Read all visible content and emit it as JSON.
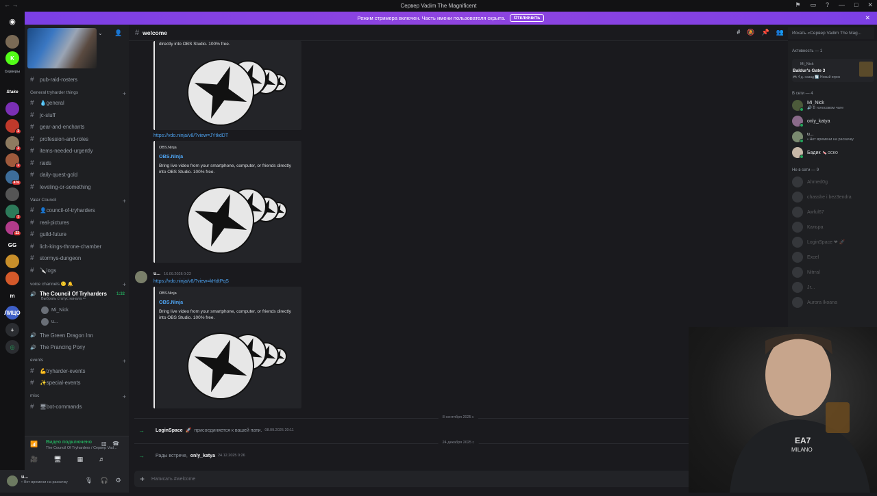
{
  "window": {
    "title": "Сервер Vadim The Magnificent"
  },
  "banner": {
    "text": "Режим стримера включен. Часть имени пользователя скрыта.",
    "button": "Отключить"
  },
  "servers": [
    {
      "icon": "discord-icon",
      "color": "#5865f2"
    },
    {
      "icon": "server-avatar",
      "color": "#7a6a55"
    },
    {
      "icon": "kick-icon",
      "color": "#53fc18",
      "label": "K"
    },
    {
      "icon": "server-label",
      "label": "Серверы"
    },
    {
      "icon": "stake-icon",
      "label": "Stake"
    },
    {
      "icon": "server-avatar",
      "color": "#7b2fb5"
    },
    {
      "icon": "server-avatar",
      "color": "#c0392b",
      "badge": "3"
    },
    {
      "icon": "server-avatar",
      "color": "#8e7b60",
      "badge": "3"
    },
    {
      "icon": "server-avatar",
      "color": "#a05a3c",
      "badge": "1"
    },
    {
      "icon": "server-avatar",
      "color": "#3d6d9a",
      "badge": "476"
    },
    {
      "icon": "server-avatar",
      "color": "#555"
    },
    {
      "icon": "server-avatar",
      "color": "#2d7a5a",
      "badge": "1"
    },
    {
      "icon": "server-avatar",
      "color": "#b23b8a",
      "badge": "22"
    },
    {
      "icon": "gg-icon",
      "label": "GG"
    },
    {
      "icon": "server-avatar",
      "color": "#c98f2a"
    },
    {
      "icon": "server-avatar",
      "color": "#d4592a"
    },
    {
      "icon": "m-icon",
      "label": "m"
    },
    {
      "icon": "server-avatar",
      "color": "#3e5fc7",
      "label": "ЛИЦО"
    },
    {
      "icon": "add-server-icon",
      "label": "+"
    },
    {
      "icon": "discover-icon"
    }
  ],
  "sidebar": {
    "channels_top": [
      {
        "name": "pub-raid-rosters"
      }
    ],
    "categories": [
      {
        "name": "General tryharder things",
        "channels": [
          "💧general",
          "jc-stuff",
          "gear-and-enchants",
          "profession-and-roles",
          "items-needed-urgently",
          "raids",
          "daily-quest-gold",
          "leveling-or-something"
        ]
      },
      {
        "name": "Valar Council",
        "channels": [
          "👤council-of-tryharders",
          "real-pictures",
          "guild-future",
          "lich-kings-throne-chamber",
          "stormys-dungeon",
          "🔪logs"
        ]
      },
      {
        "name": "voice channels 🙂 🔔",
        "voice": [
          {
            "name": "The Council Of Tryharders",
            "active": true,
            "time": "1:32",
            "status": "Выбрать статус канала ✏",
            "users": [
              "Mi_Nick",
              "u..."
            ]
          },
          {
            "name": "The Green Dragon Inn"
          },
          {
            "name": "The Prancing Pony"
          }
        ]
      },
      {
        "name": "events",
        "channels": [
          "💪tryharder-events",
          "✨special-events"
        ]
      },
      {
        "name": "misc",
        "channels": [
          "🖥bot-commands"
        ]
      }
    ]
  },
  "voice_panel": {
    "status": "Видео подключено",
    "channel": "The Council Of Tryharders / Сервер Vad..."
  },
  "user_panel": {
    "name": "u...",
    "status": "• Нет времени на раскачку"
  },
  "channel": {
    "name": "welcome",
    "composer_placeholder": "Написать #welcome"
  },
  "messages": {
    "embed_top_desc_tail": "directly into OBS Studio. 100% free.",
    "link1": "https://vdo.ninja/v8/?view=JYtkdDT",
    "embed": {
      "provider": "OBS.Ninja",
      "title": "OBS.Ninja",
      "description": "Bring live video from your smartphone, computer, or friends directly into OBS Studio. 100% free."
    },
    "msg2": {
      "author": "u...",
      "timestamp": "16.09.2025 0:22",
      "link": "https://vdo.ninja/v8/?view=kHdtPqS"
    },
    "divider1": "8 сентября 2025 г.",
    "join1": {
      "name": "LoginSpace",
      "emoji": "🚀",
      "text": "присоединяется к вашей пати.",
      "timestamp": "08.09.2025 20:11"
    },
    "divider2": "24 декабря 2025 г.",
    "join2": {
      "prefix": "Рады встрече,",
      "name": "only_katya",
      "timestamp": "24.12.2025 0:26"
    }
  },
  "search": {
    "placeholder": "Искать «Сервер Vadim The Mag..."
  },
  "members": {
    "activity_header": "Активность — 1",
    "activity": {
      "user": "Mi_Nick",
      "game": "Baldur's Gate 3",
      "meta": "🎮 4 д. назад  🔄 Новый игрок"
    },
    "online_header": "В сети — 4",
    "online": [
      {
        "name": "Mi_Nick",
        "sub": "🔊 В голосовом чате",
        "color": "#4c5a3a"
      },
      {
        "name": "only_katya",
        "sub": "",
        "color": "#8a6a8a"
      },
      {
        "name": "u...",
        "sub": "• Нет времени на раскачку",
        "color": "#7a8a70"
      },
      {
        "name": "Бадик",
        "sub": "",
        "color": "#c7b8a8",
        "tag": "🍬 GCKO"
      }
    ],
    "offline_header": "Не в сети — 9",
    "offline": [
      "Ahmed0g",
      "chasshe i bez3endra",
      "Awful67",
      "Кальра",
      "LoginSpace ❤ 🚀",
      "Excel",
      "Nitrral",
      "Jr...",
      "Aurora Ikoana"
    ]
  }
}
